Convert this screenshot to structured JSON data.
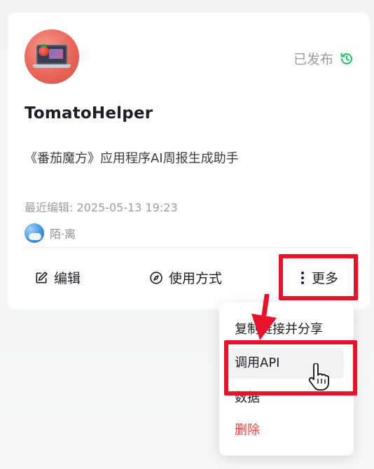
{
  "card": {
    "title": "TomatoHelper",
    "description": "《番茄魔方》应用程序AI周报生成助手",
    "status": "已发布",
    "status_icon": "history-icon",
    "last_edited": "最近编辑: 2025-05-13 19:23",
    "author": "陌·离",
    "avatar_icon": "laptop-tomato-icon"
  },
  "actions": {
    "edit_label": "编辑",
    "usage_label": "使用方式",
    "more_label": "更多"
  },
  "menu": {
    "items": [
      {
        "label": "复制链接并分享"
      },
      {
        "label": "调用API"
      },
      {
        "label": "数据"
      },
      {
        "label": "删除"
      }
    ]
  },
  "colors": {
    "accent_green": "#2fbf71",
    "annotation_red": "#e8132a",
    "danger": "#e8453c"
  }
}
